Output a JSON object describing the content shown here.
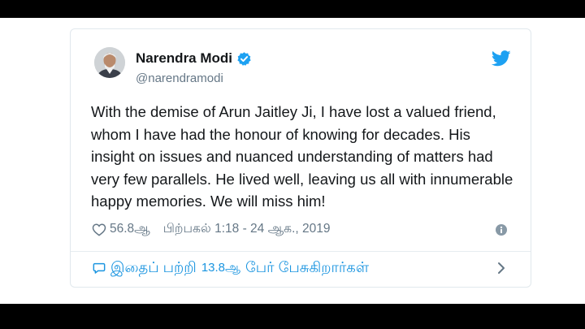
{
  "tweet": {
    "display_name": "Narendra Modi",
    "handle": "@narendramodi",
    "verified_icon": "verified-badge-icon",
    "brand_icon": "twitter-bird-icon",
    "text": "With the demise of Arun Jaitley Ji, I have lost a valued friend, whom I have had the honour of knowing for decades. His insight on issues and nuanced understanding of matters had very few parallels. He lived well, leaving us all with innumerable happy memories. We will miss him!",
    "likes": "56.8ஆ",
    "timestamp": "பிற்பகல் 1:18 - 24 ஆக., 2019",
    "conversation_prefix": "இதைப் பற்றி",
    "conversation_count": "13.8ஆ",
    "conversation_suffix": "பேர் பேசுகிறார்கள்"
  },
  "colors": {
    "accent": "#1da1f2",
    "link": "#1b95e0",
    "text": "#14171a",
    "muted": "#657786",
    "border": "#e1e8ed"
  }
}
